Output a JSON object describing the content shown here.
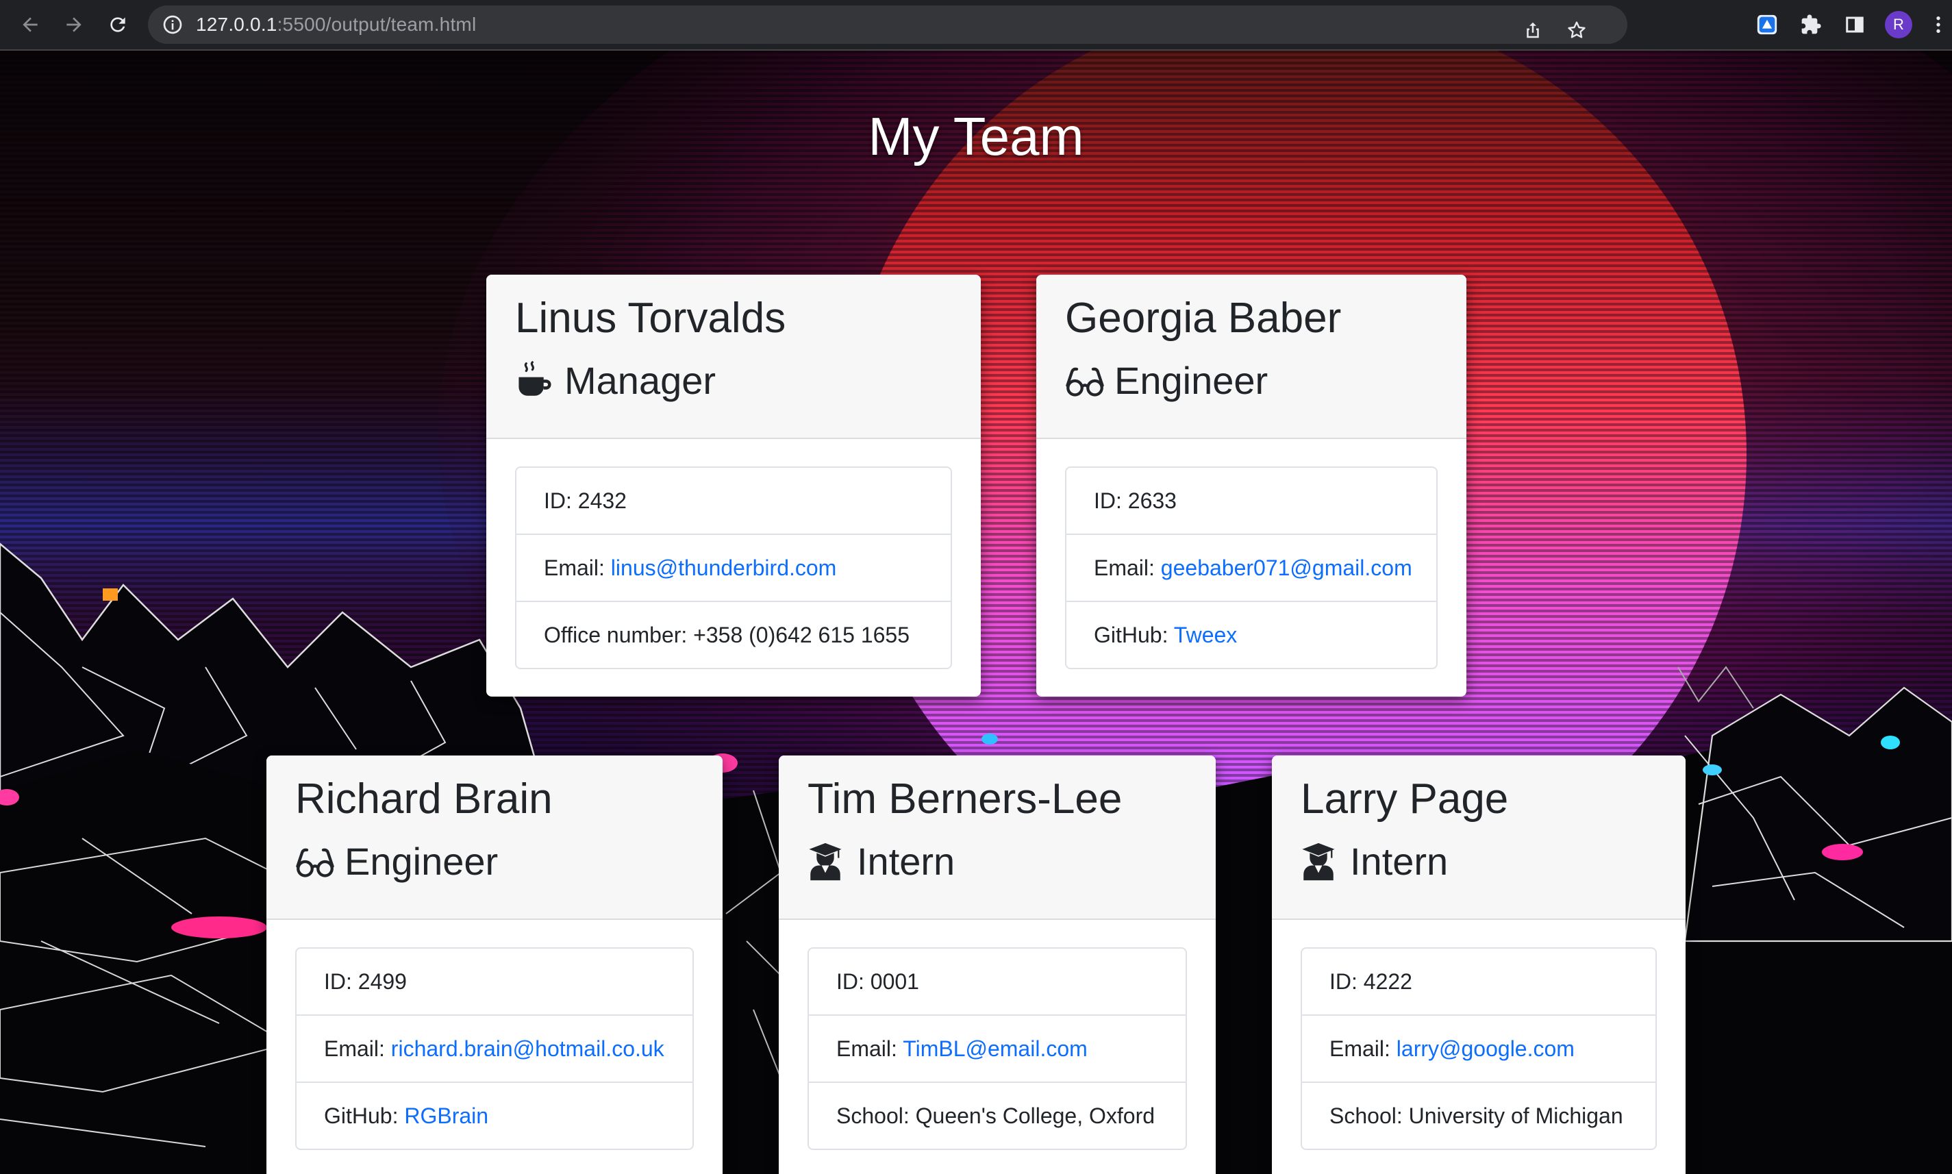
{
  "browser": {
    "url_host": "127.0.0.1",
    "url_path": ":5500/output/team.html",
    "profile_initial": "R"
  },
  "page": {
    "title": "My Team"
  },
  "team": [
    {
      "name": "Linus Torvalds",
      "role": "Manager",
      "role_icon": "mug-icon",
      "id_label": "ID:",
      "id": "2432",
      "email_label": "Email:",
      "email": "linus@thunderbird.com",
      "extra_label": "Office number:",
      "extra": "+358 (0)642 615 1655",
      "extra_is_link": false
    },
    {
      "name": "Georgia Baber",
      "role": "Engineer",
      "role_icon": "glasses-icon",
      "id_label": "ID:",
      "id": "2633",
      "email_label": "Email:",
      "email": "geebaber071@gmail.com",
      "extra_label": "GitHub:",
      "extra": "Tweex",
      "extra_is_link": true
    },
    {
      "name": "Richard Brain",
      "role": "Engineer",
      "role_icon": "glasses-icon",
      "id_label": "ID:",
      "id": "2499",
      "email_label": "Email:",
      "email": "richard.brain@hotmail.co.uk",
      "extra_label": "GitHub:",
      "extra": "RGBrain",
      "extra_is_link": true
    },
    {
      "name": "Tim Berners-Lee",
      "role": "Intern",
      "role_icon": "graduate-icon",
      "id_label": "ID:",
      "id": "0001",
      "email_label": "Email:",
      "email": "TimBL@email.com",
      "extra_label": "School:",
      "extra": "Queen's College, Oxford",
      "extra_is_link": false
    },
    {
      "name": "Larry Page",
      "role": "Intern",
      "role_icon": "graduate-icon",
      "id_label": "ID:",
      "id": "4222",
      "email_label": "Email:",
      "email": "larry@google.com",
      "extra_label": "School:",
      "extra": "University of Michigan",
      "extra_is_link": false
    }
  ],
  "colors": {
    "link": "#0d6efd",
    "card_header": "#f7f7f7",
    "chrome": "#202124"
  }
}
